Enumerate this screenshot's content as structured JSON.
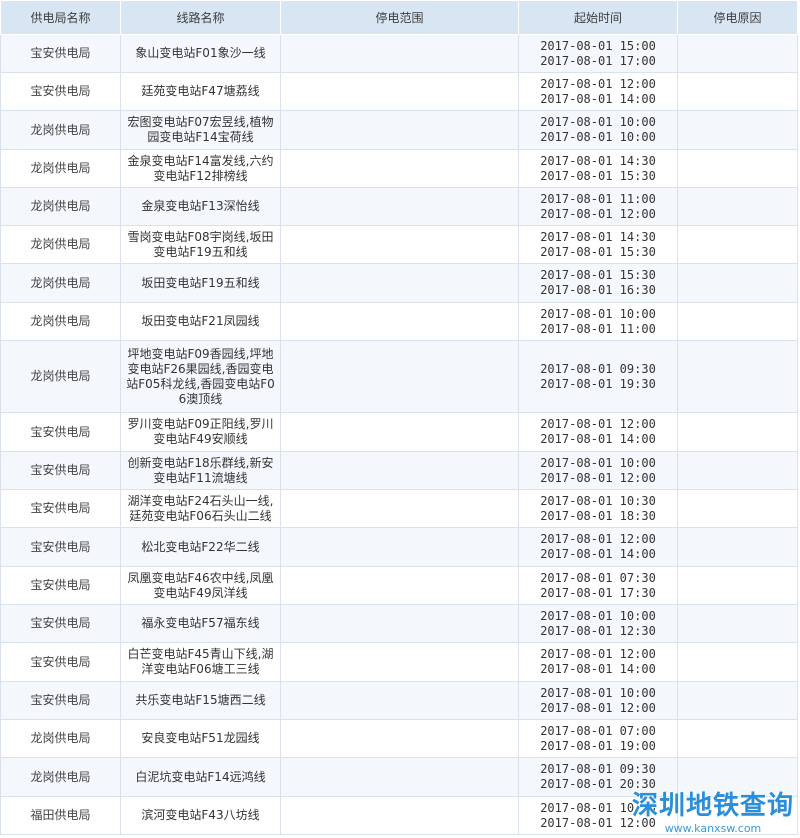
{
  "headers": [
    "供电局名称",
    "线路名称",
    "停电范围",
    "起始时间",
    "停电原因"
  ],
  "rows": [
    {
      "bureau": "宝安供电局",
      "line": "象山变电站F01象沙一线",
      "scope": "",
      "start": "2017-08-01 15:00",
      "end": "2017-08-01 17:00",
      "reason": ""
    },
    {
      "bureau": "宝安供电局",
      "line": "廷苑变电站F47塘荔线",
      "scope": "",
      "start": "2017-08-01 12:00",
      "end": "2017-08-01 14:00",
      "reason": ""
    },
    {
      "bureau": "龙岗供电局",
      "line": "宏图变电站F07宏昱线,植物园变电站F14宝荷线",
      "scope": "",
      "start": "2017-08-01 10:00",
      "end": "2017-08-01 10:00",
      "reason": ""
    },
    {
      "bureau": "龙岗供电局",
      "line": "金泉变电站F14富发线,六约变电站F12排榜线",
      "scope": "",
      "start": "2017-08-01 14:30",
      "end": "2017-08-01 15:30",
      "reason": ""
    },
    {
      "bureau": "龙岗供电局",
      "line": "金泉变电站F13深怡线",
      "scope": "",
      "start": "2017-08-01 11:00",
      "end": "2017-08-01 12:00",
      "reason": ""
    },
    {
      "bureau": "龙岗供电局",
      "line": "雪岗变电站F08宇岗线,坂田变电站F19五和线",
      "scope": "",
      "start": "2017-08-01 14:30",
      "end": "2017-08-01 15:30",
      "reason": ""
    },
    {
      "bureau": "龙岗供电局",
      "line": "坂田变电站F19五和线",
      "scope": "",
      "start": "2017-08-01 15:30",
      "end": "2017-08-01 16:30",
      "reason": ""
    },
    {
      "bureau": "龙岗供电局",
      "line": "坂田变电站F21凤园线",
      "scope": "",
      "start": "2017-08-01 10:00",
      "end": "2017-08-01 11:00",
      "reason": ""
    },
    {
      "bureau": "龙岗供电局",
      "line": "坪地变电站F09香园线,坪地变电站F26果园线,香园变电站F05科龙线,香园变电站F06澳顶线",
      "scope": "",
      "start": "2017-08-01 09:30",
      "end": "2017-08-01 19:30",
      "reason": ""
    },
    {
      "bureau": "宝安供电局",
      "line": "罗川变电站F09正阳线,罗川变电站F49安顺线",
      "scope": "",
      "start": "2017-08-01 12:00",
      "end": "2017-08-01 14:00",
      "reason": ""
    },
    {
      "bureau": "宝安供电局",
      "line": "创新变电站F18乐群线,新安变电站F11流塘线",
      "scope": "",
      "start": "2017-08-01 10:00",
      "end": "2017-08-01 12:00",
      "reason": ""
    },
    {
      "bureau": "宝安供电局",
      "line": "湖洋变电站F24石头山一线,廷苑变电站F06石头山二线",
      "scope": "",
      "start": "2017-08-01 10:30",
      "end": "2017-08-01 18:30",
      "reason": ""
    },
    {
      "bureau": "宝安供电局",
      "line": "松北变电站F22华二线",
      "scope": "",
      "start": "2017-08-01 12:00",
      "end": "2017-08-01 14:00",
      "reason": ""
    },
    {
      "bureau": "宝安供电局",
      "line": "凤凰变电站F46农中线,凤凰变电站F49凤洋线",
      "scope": "",
      "start": "2017-08-01 07:30",
      "end": "2017-08-01 17:30",
      "reason": ""
    },
    {
      "bureau": "宝安供电局",
      "line": "福永变电站F57福东线",
      "scope": "",
      "start": "2017-08-01 10:00",
      "end": "2017-08-01 12:30",
      "reason": ""
    },
    {
      "bureau": "宝安供电局",
      "line": "白芒变电站F45青山下线,湖洋变电站F06塘工三线",
      "scope": "",
      "start": "2017-08-01 12:00",
      "end": "2017-08-01 14:00",
      "reason": ""
    },
    {
      "bureau": "宝安供电局",
      "line": "共乐变电站F15塘西二线",
      "scope": "",
      "start": "2017-08-01 10:00",
      "end": "2017-08-01 12:00",
      "reason": ""
    },
    {
      "bureau": "龙岗供电局",
      "line": "安良变电站F51龙园线",
      "scope": "",
      "start": "2017-08-01 07:00",
      "end": "2017-08-01 19:00",
      "reason": ""
    },
    {
      "bureau": "龙岗供电局",
      "line": "白泥坑变电站F14远鸿线",
      "scope": "",
      "start": "2017-08-01 09:30",
      "end": "2017-08-01 20:30",
      "reason": ""
    },
    {
      "bureau": "福田供电局",
      "line": "滨河变电站F43八坊线",
      "scope": "",
      "start": "2017-08-01 10:00",
      "end": "2017-08-01 12:00",
      "reason": ""
    }
  ],
  "watermark": {
    "title": "深圳地铁查询",
    "url": "www.kanxsw.com"
  }
}
